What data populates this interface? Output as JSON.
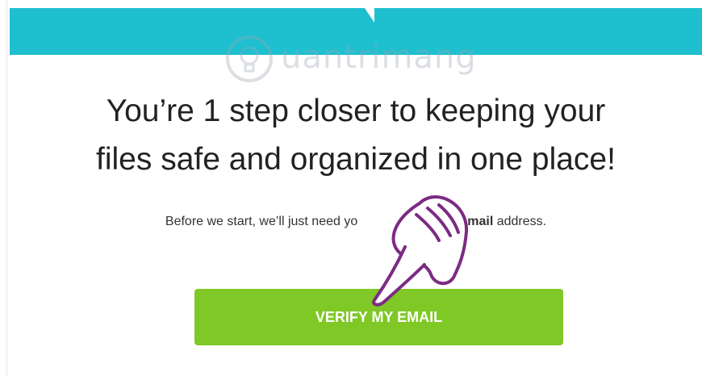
{
  "watermark": {
    "text": "uantrimang"
  },
  "headline": {
    "line1": "You’re 1 step closer to keeping your",
    "line2": "files safe and organized in one place!"
  },
  "subtext": {
    "before": "Before we start, we’ll just need yo",
    "emphasis": "your email",
    "after": " address."
  },
  "button": {
    "label": "VERIFY MY EMAIL"
  },
  "colors": {
    "banner": "#1ebfcf",
    "button": "#7fc826",
    "hand_outline": "#7b2b83"
  },
  "icons": {
    "pointer": "pointing-hand-icon",
    "logo": "lightbulb-logo-icon"
  }
}
